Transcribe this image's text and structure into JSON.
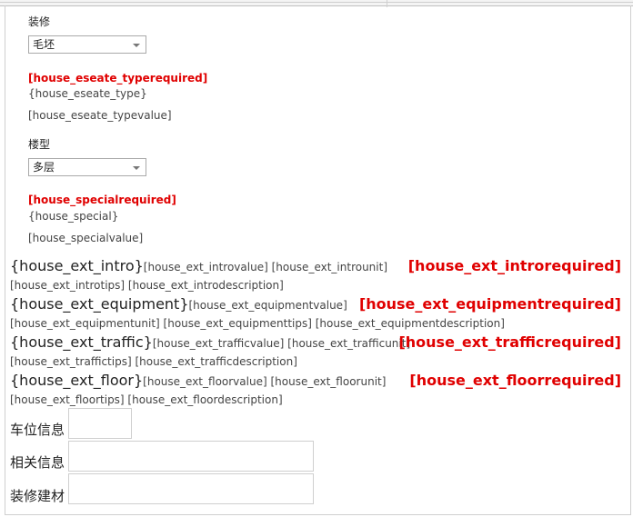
{
  "section1": {
    "label": "装修",
    "select_value": "毛坯",
    "required": "[house_eseate_typerequired]",
    "field": "{house_eseate_type}",
    "value": "[house_eseate_typevalue]"
  },
  "section2": {
    "label": "楼型",
    "select_value": "多层",
    "required": "[house_specialrequired]",
    "field": "{house_special}",
    "value": "[house_specialvalue]"
  },
  "ext": [
    {
      "field": "{house_ext_intro}",
      "inline": "[house_ext_introvalue] [house_ext_introunit]",
      "line2": "[house_ext_introtips] [house_ext_introdescription]",
      "required": "[house_ext_introrequired]"
    },
    {
      "field": "{house_ext_equipment}",
      "inline": "[house_ext_equipmentvalue]",
      "line2": "[house_ext_equipmentunit] [house_ext_equipmenttips] [house_ext_equipmentdescription]",
      "required": "[house_ext_equipmentrequired]"
    },
    {
      "field": "{house_ext_traffic}",
      "inline": "[house_ext_trafficvalue] [house_ext_trafficunit]",
      "line2": "[house_ext_traffictips] [house_ext_trafficdescription]",
      "required": "[house_ext_trafficrequired]"
    },
    {
      "field": "{house_ext_floor}",
      "inline": "[house_ext_floorvalue] [house_ext_floorunit]",
      "line2": "[house_ext_floortips] [house_ext_floordescription]",
      "required": "[house_ext_floorrequired]"
    }
  ],
  "bottom_fields": [
    {
      "label": "车位信息"
    },
    {
      "label": "相关信息"
    },
    {
      "label": "装修建材"
    }
  ]
}
